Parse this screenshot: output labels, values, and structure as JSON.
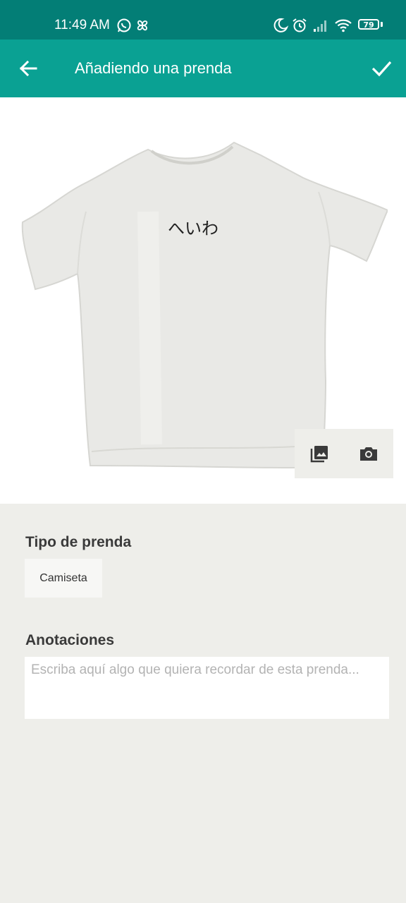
{
  "status_bar": {
    "time": "11:49 AM",
    "battery_level": "79",
    "icons": [
      "whatsapp-icon",
      "pinwheel-icon",
      "do-not-disturb-moon-icon",
      "alarm-icon",
      "signal-icon",
      "wifi-icon",
      "battery-icon"
    ]
  },
  "app_bar": {
    "title": "Añadiendo una prenda",
    "back_icon": "arrow-back-icon",
    "confirm_icon": "check-icon"
  },
  "garment_image": {
    "print_text": "へいわ",
    "gallery_icon": "photo-library-icon",
    "camera_icon": "camera-icon"
  },
  "form": {
    "type_label": "Tipo de prenda",
    "type_value": "Camiseta",
    "notes_label": "Anotaciones",
    "notes_placeholder": "Escriba aquí algo que quiera recordar de esta prenda...",
    "notes_value": ""
  },
  "colors": {
    "status_bar": "#037e76",
    "app_bar": "#0aa193",
    "background": "#eeeeea"
  }
}
